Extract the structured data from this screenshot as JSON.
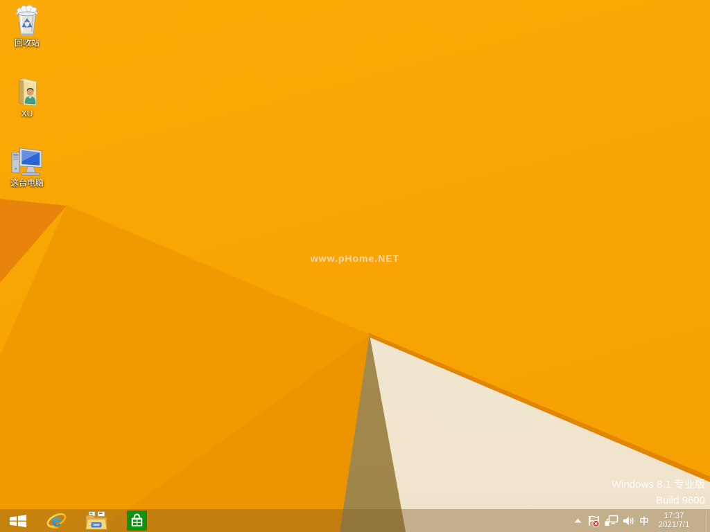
{
  "desktop": {
    "icons": [
      {
        "name": "recycle-bin",
        "label": "回收站"
      },
      {
        "name": "xu-user-folder",
        "label": "XU"
      },
      {
        "name": "this-pc",
        "label": "这台电脑"
      }
    ],
    "watermark": "www.pHome.NET",
    "edition_line1": "Windows 8.1 专业版",
    "edition_line2": "Build 9600"
  },
  "taskbar": {
    "apps": [
      {
        "name": "start-button"
      },
      {
        "name": "internet-explorer"
      },
      {
        "name": "file-explorer"
      },
      {
        "name": "windows-store"
      }
    ],
    "tray": {
      "icons": [
        "hidden-icons-chevron",
        "action-center-flag",
        "network",
        "volume",
        "ime-indicator",
        "show-desktop"
      ],
      "ime": "中",
      "time": "17:37",
      "date": "2021/7/1"
    }
  },
  "colors": {
    "wallpaper_orange": "#f8a503",
    "wallpaper_dark_facet": "#e8830b",
    "wallpaper_tan_facet": "#a68e55",
    "wallpaper_cream_facet": "#f2e9d6",
    "taskbar_tint": "rgba(125,92,40,0.38)",
    "store_green": "#119311",
    "text_white": "#ffffff"
  }
}
